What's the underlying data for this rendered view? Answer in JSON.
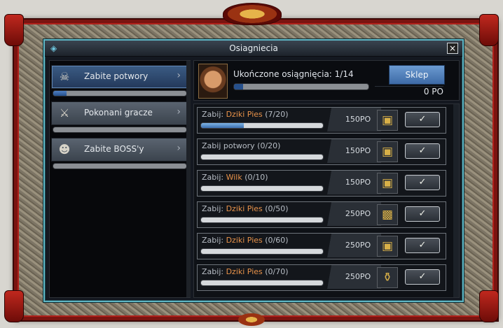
{
  "window": {
    "title": "Osiagniecia",
    "close_icon": "×"
  },
  "categories": [
    {
      "label": "Zabite potwory",
      "icon": "skull-icon",
      "glyph": "☠",
      "active": true,
      "progress": 0.1
    },
    {
      "label": "Pokonani gracze",
      "icon": "crossed-swords-icon",
      "glyph": "⚔",
      "active": false,
      "progress": 0
    },
    {
      "label": "Zabite BOSS'y",
      "icon": "demon-icon",
      "glyph": "☻",
      "active": false,
      "progress": 0
    }
  ],
  "header": {
    "achievements_label": "Ukończone osiągnięcia: 1/14",
    "achievements_progress": 0.07,
    "shop_label": "Sklep",
    "gold": "0 PO"
  },
  "tasks": [
    {
      "prefix": "Zabij: ",
      "target": "Dziki Pies",
      "count": " (7/20)",
      "progress": 0.35,
      "reward": "150PO",
      "reward_icon": "gold-chest-icon",
      "reward_glyph": "▣",
      "claim": "✓"
    },
    {
      "prefix": "Zabij potwory (0/20)",
      "target": "",
      "count": "",
      "progress": 0,
      "reward": "150PO",
      "reward_icon": "wooden-chest-icon",
      "reward_glyph": "▣",
      "claim": "✓"
    },
    {
      "prefix": "Zabij: ",
      "target": "Wilk",
      "count": " (0/10)",
      "progress": 0,
      "reward": "150PO",
      "reward_icon": "gold-chest-icon",
      "reward_glyph": "▣",
      "claim": "✓"
    },
    {
      "prefix": "Zabij: ",
      "target": "Dziki Pies",
      "count": " (0/50)",
      "progress": 0,
      "reward": "250PO",
      "reward_icon": "ornate-chest-icon",
      "reward_glyph": "▩",
      "claim": "✓"
    },
    {
      "prefix": "Zabij: ",
      "target": "Dziki Pies",
      "count": " (0/60)",
      "progress": 0,
      "reward": "250PO",
      "reward_icon": "wooden-chest-icon",
      "reward_glyph": "▣",
      "claim": "✓"
    },
    {
      "prefix": "Zabij: ",
      "target": "Dziki Pies",
      "count": " (0/70)",
      "progress": 0,
      "reward": "250PO",
      "reward_icon": "potion-icon",
      "reward_glyph": "⚱",
      "claim": "✓"
    }
  ]
}
